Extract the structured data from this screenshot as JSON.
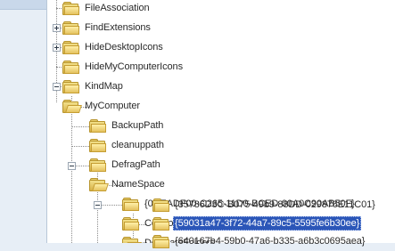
{
  "tree": {
    "nodes": [
      {
        "label": "FileAssociation"
      },
      {
        "label": "FindExtensions"
      },
      {
        "label": "HideDesktopIcons"
      },
      {
        "label": "HideMyComputerIcons"
      },
      {
        "label": "KindMap"
      },
      {
        "label": "MyComputer"
      },
      {
        "label": "BackupPath"
      },
      {
        "label": "cleanuppath"
      },
      {
        "label": "DefragPath"
      },
      {
        "label": "NameSpace"
      },
      {
        "label": "{0DEADF00-C265-11D0-BCED-00A0C90AB50F}"
      },
      {
        "label": "Controls"
      },
      {
        "label": "DelegateFolders"
      },
      {
        "label": "{35786D3C-B075-49b9-88DD-029876E11C01}"
      },
      {
        "label": "{59031a47-3f72-44a7-89c5-5595fe6b30ee}",
        "selected": true
      },
      {
        "label": "{640167b4-59b0-47a6-b335-a6b3c0695aea}"
      }
    ]
  }
}
